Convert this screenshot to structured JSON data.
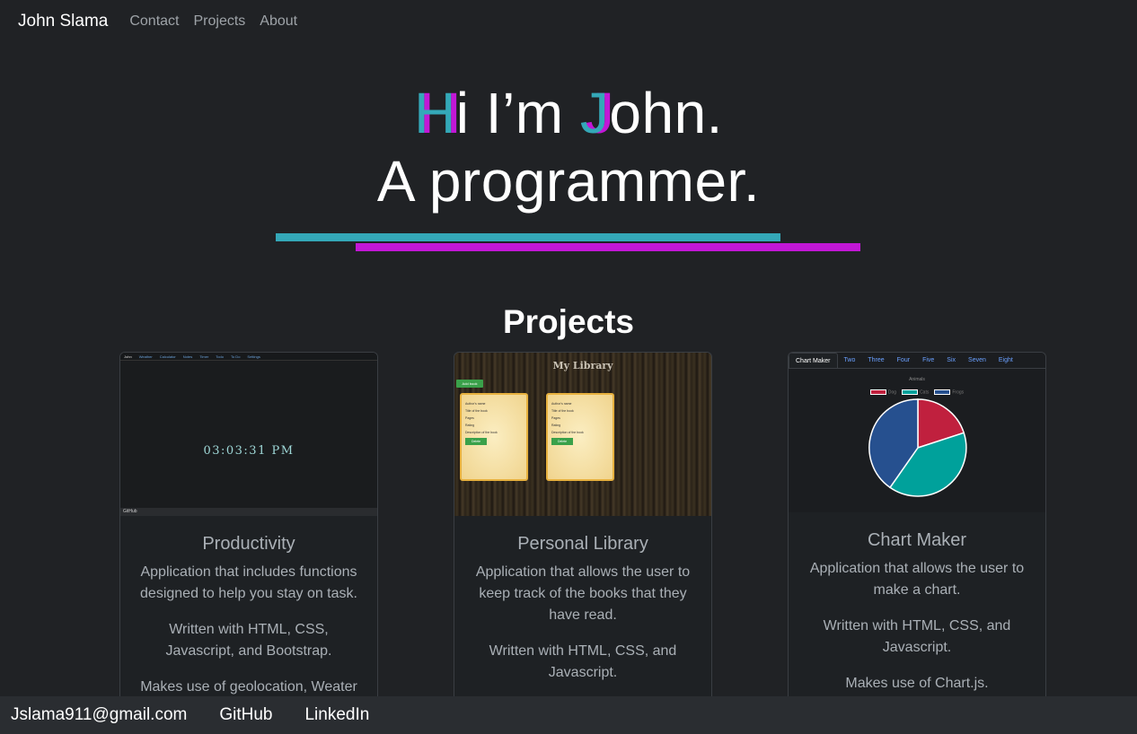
{
  "nav": {
    "brand": "John Slama",
    "links": [
      "Contact",
      "Projects",
      "About"
    ]
  },
  "hero": {
    "initial_h": "H",
    "rest1": "i I’m ",
    "initial_j": "J",
    "rest2": "ohn.",
    "line2": "A programmer.",
    "accent_teal": "#34a8b8",
    "accent_magenta": "#c217d6"
  },
  "projects": {
    "title": "Projects",
    "cards": [
      {
        "title": "Productivity",
        "paras": [
          "Application that includes functions designed to help you stay on task.",
          "Written with HTML, CSS, Javascript, and Bootstrap.",
          "Makes use of geolocation, Weater"
        ],
        "thumb": {
          "nav_items": [
            "John",
            "Weather",
            "Calculator",
            "Notes",
            "Timer",
            "Todo",
            "To Do",
            "Settings"
          ],
          "clock": "03:03:31 PM",
          "footer": "GitHub"
        }
      },
      {
        "title": "Personal Library",
        "paras": [
          "Application that allows the user to keep track of the books that they have read.",
          "Written with HTML, CSS, and Javascript."
        ],
        "thumb": {
          "heading": "My Library",
          "add_button": "Add book",
          "book_lines": [
            "Author's name",
            "Title of the book",
            "Pages",
            "Rating",
            "Description of the book"
          ],
          "book_button": "Delete"
        }
      },
      {
        "title": "Chart Maker",
        "paras": [
          "Application that allows the user to make a chart.",
          "Written with HTML, CSS, and Javascript.",
          "Makes use of Chart.js."
        ],
        "thumb": {
          "tabs": [
            "Chart Maker",
            "Two",
            "Three",
            "Four",
            "Five",
            "Six",
            "Seven",
            "Eight"
          ],
          "chart_title": "Animals",
          "legend": [
            {
              "label": "Dog",
              "color": "#c0203e"
            },
            {
              "label": "Cats",
              "color": "#00a19b"
            },
            {
              "label": "Frogs",
              "color": "#26508f"
            }
          ]
        }
      }
    ]
  },
  "footer": {
    "links": [
      "Jslama911@gmail.com",
      "GitHub",
      "LinkedIn"
    ]
  }
}
